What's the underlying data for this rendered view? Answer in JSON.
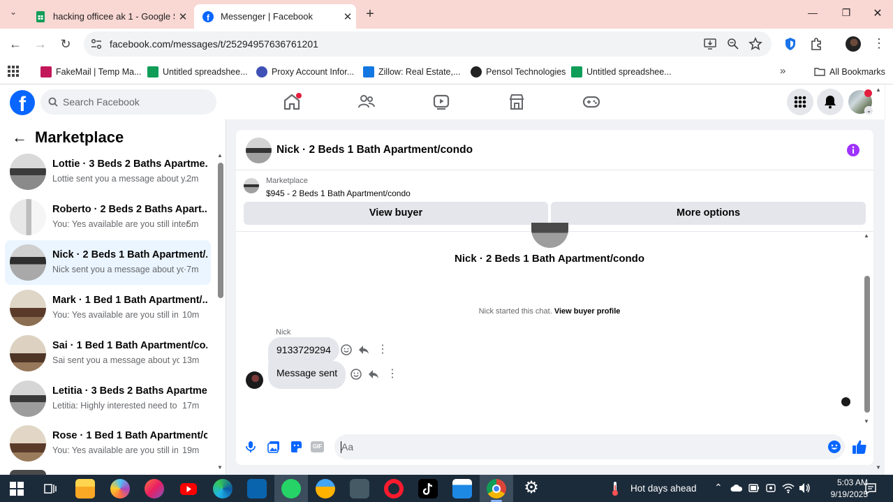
{
  "browser": {
    "tabs": [
      {
        "title": "hacking officee ak 1 - Google S",
        "icon": "sheets-icon"
      },
      {
        "title": "Messenger | Facebook",
        "icon": "facebook-icon"
      }
    ],
    "url": "facebook.com/messages/t/25294957636761201",
    "bookmarks": [
      {
        "label": "FakeMail | Temp Ma...",
        "color": "#c2185b"
      },
      {
        "label": "Untitled spreadshee...",
        "color": "#0f9d58"
      },
      {
        "label": "Proxy Account Infor...",
        "color": "#3f51b5"
      },
      {
        "label": "Zillow: Real Estate,...",
        "color": "#1277e1"
      },
      {
        "label": "Pensol Technologies",
        "color": "#222222"
      },
      {
        "label": "Untitled spreadshee...",
        "color": "#0f9d58"
      }
    ],
    "all_bookmarks": "All Bookmarks"
  },
  "facebook": {
    "search_placeholder": "Search Facebook",
    "brand_color": "#0866ff"
  },
  "sidebar": {
    "title": "Marketplace",
    "conversations": [
      {
        "name": "Lottie · 3 Beds 2 Baths Apartme...",
        "preview": "Lottie sent you a message about y...",
        "time": "2m"
      },
      {
        "name": "Roberto · 2 Beds 2 Baths Apart...",
        "preview": "You: Yes available are you still inter...",
        "time": "5m"
      },
      {
        "name": "Nick · 2 Beds 1 Bath Apartment/...",
        "preview": "Nick sent you a message about yo...",
        "time": "·7m"
      },
      {
        "name": "Mark · 1 Bed 1 Bath Apartment/...",
        "preview": "You: Yes available are you still int...",
        "time": "10m"
      },
      {
        "name": "Sai · 1 Bed 1 Bath Apartment/co...",
        "preview": "Sai sent you a message about yo...",
        "time": "13m"
      },
      {
        "name": "Letitia · 3 Beds 2 Baths Apartme...",
        "preview": "Letitia: Highly interested need to ...",
        "time": "17m"
      },
      {
        "name": "Rose · 1 Bed 1 Bath Apartment/c...",
        "preview": "You: Yes available are you still int...",
        "time": "19m"
      }
    ]
  },
  "chat": {
    "title": "Nick · 2 Beds 1 Bath Apartment/condo",
    "listing_label": "Marketplace",
    "listing_detail": "$945 - 2 Beds 1 Bath Apartment/condo",
    "view_buyer": "View buyer",
    "more_options": "More options",
    "profile_name": "Nick · 2 Beds 1 Bath Apartment/condo",
    "started_text": "Nick started this chat.",
    "view_buyer_profile": "View buyer profile",
    "sender": "Nick",
    "messages": [
      {
        "text": "9133729294"
      },
      {
        "text": "Message sent"
      }
    ],
    "composer_placeholder": "Aa",
    "accent": "#0866ff"
  },
  "taskbar": {
    "weather": "Hot days ahead",
    "time": "5:03 AM",
    "date": "9/19/2025"
  }
}
